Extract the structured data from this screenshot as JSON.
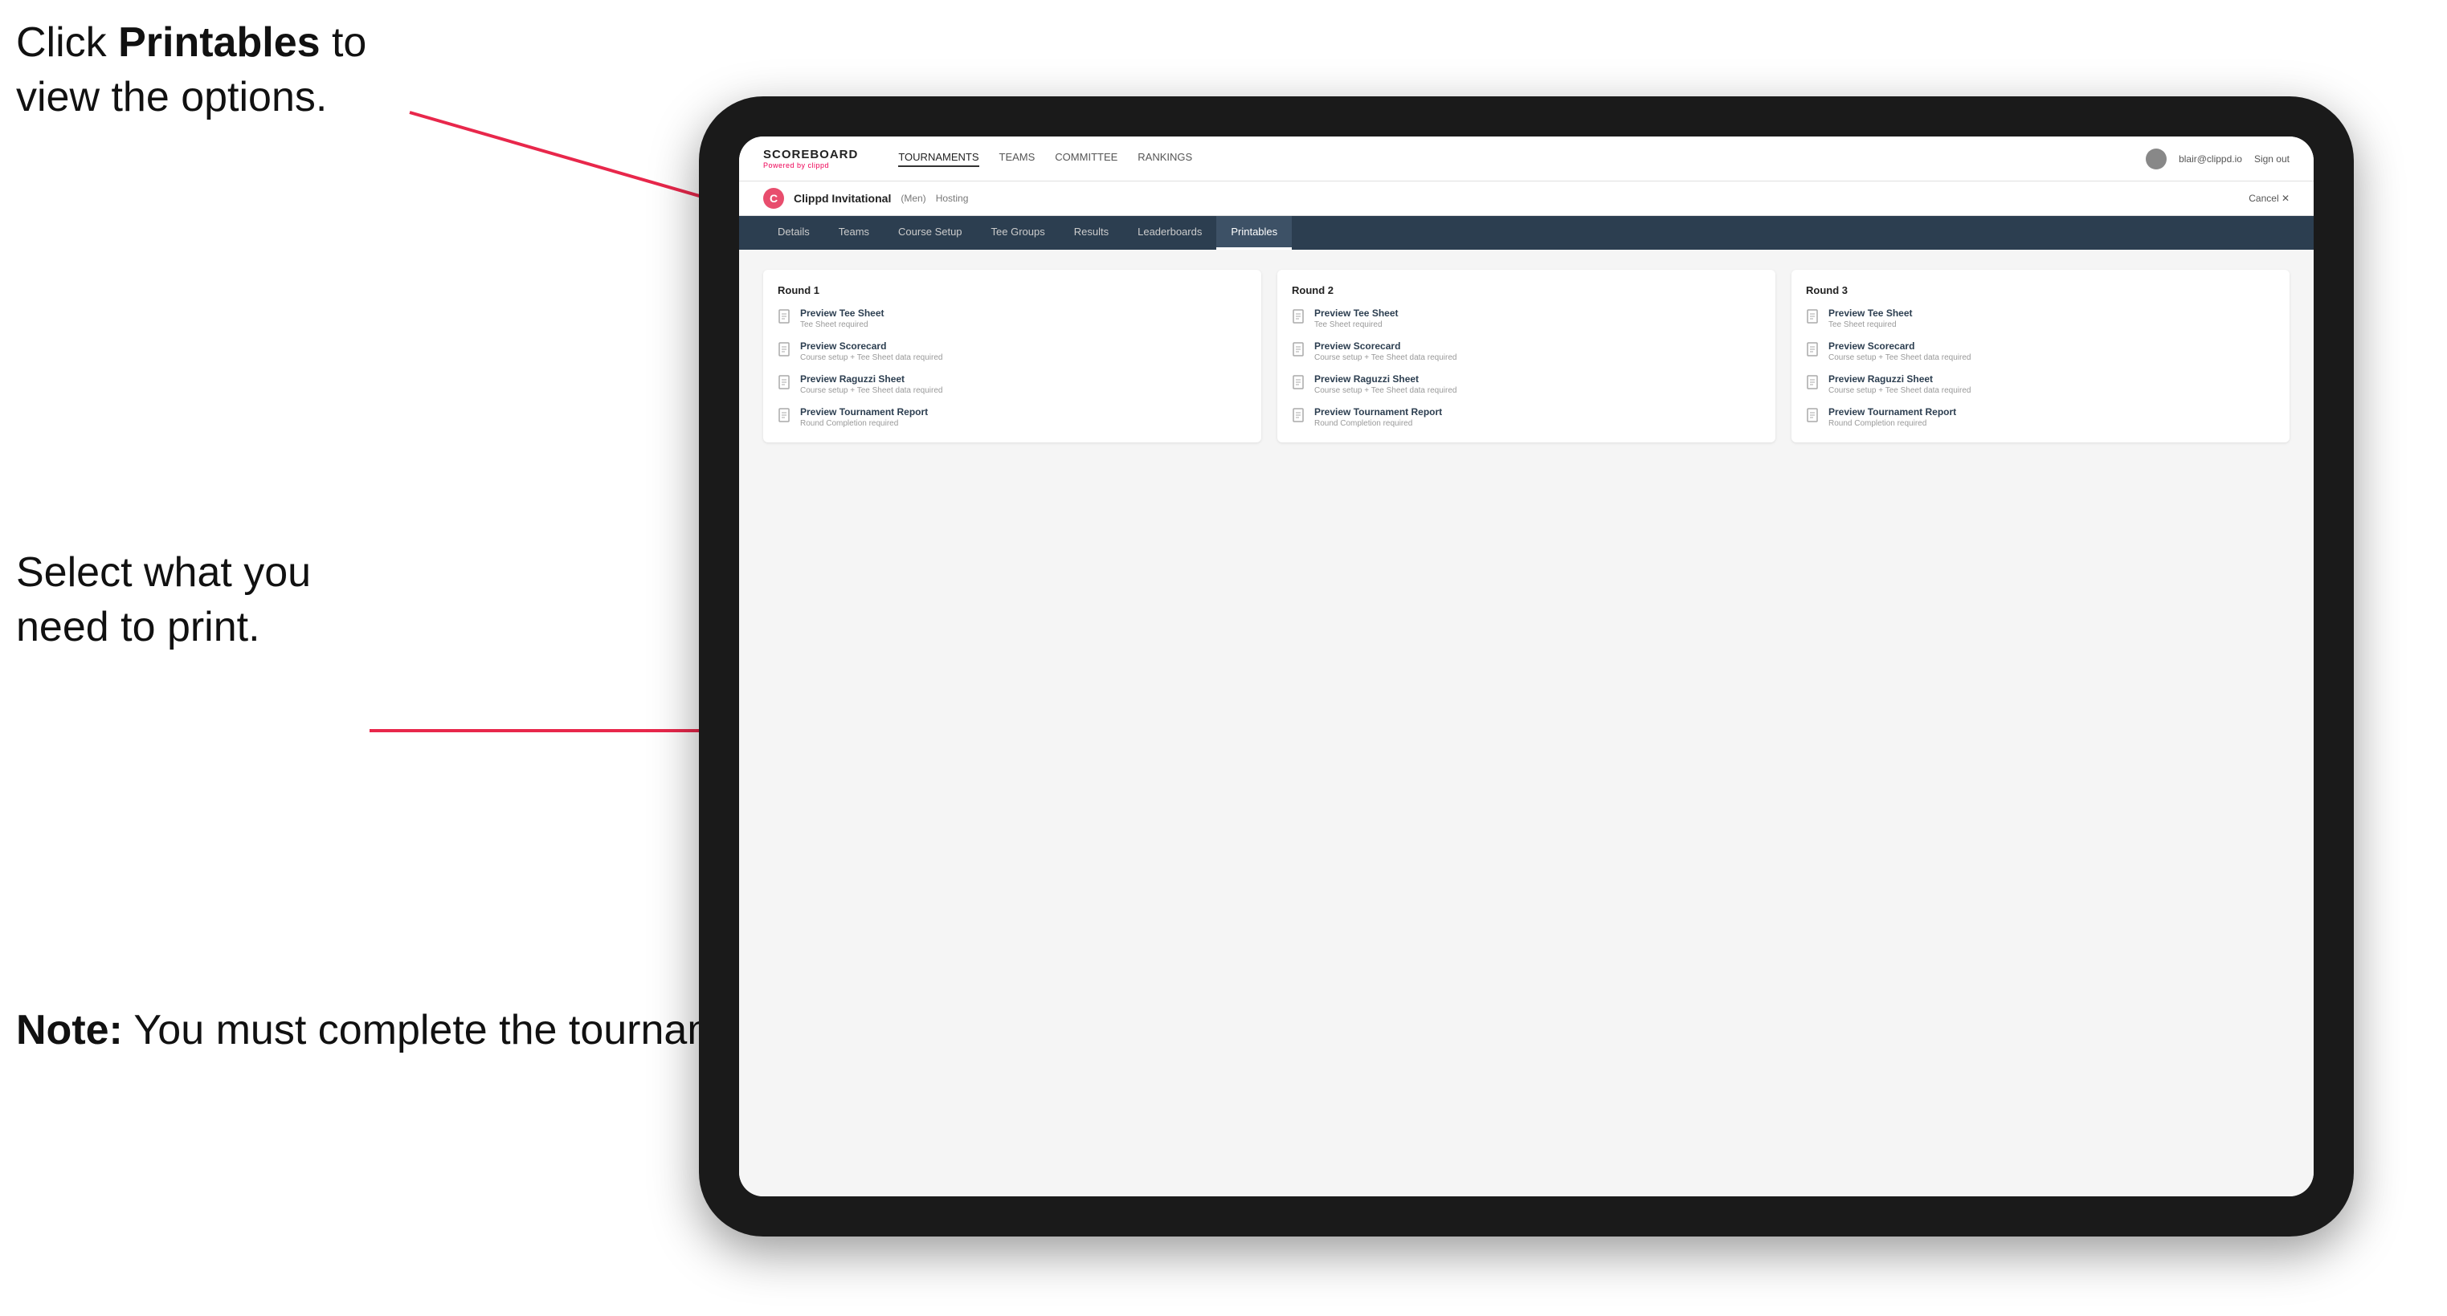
{
  "annotations": {
    "top_line1": "Click ",
    "top_bold": "Printables",
    "top_line2": " to",
    "top_line3": "view the options.",
    "middle_line1": "Select what you",
    "middle_line2": "need to print.",
    "bottom_bold": "Note:",
    "bottom_text": " You must complete the tournament set-up to print all the options."
  },
  "nav": {
    "logo": "SCOREBOARD",
    "logo_sub": "Powered by clippd",
    "links": [
      "TOURNAMENTS",
      "TEAMS",
      "COMMITTEE",
      "RANKINGS"
    ],
    "active_link": "TOURNAMENTS",
    "user_email": "blair@clippd.io",
    "sign_out": "Sign out"
  },
  "tournament": {
    "icon": "C",
    "name": "Clippd Invitational",
    "tag": "(Men)",
    "status": "Hosting",
    "cancel": "Cancel ✕"
  },
  "sub_nav": {
    "tabs": [
      "Details",
      "Teams",
      "Course Setup",
      "Tee Groups",
      "Results",
      "Leaderboards",
      "Printables"
    ],
    "active": "Printables"
  },
  "rounds": [
    {
      "title": "Round 1",
      "items": [
        {
          "title": "Preview Tee Sheet",
          "sub": "Tee Sheet required"
        },
        {
          "title": "Preview Scorecard",
          "sub": "Course setup + Tee Sheet data required"
        },
        {
          "title": "Preview Raguzzi Sheet",
          "sub": "Course setup + Tee Sheet data required"
        },
        {
          "title": "Preview Tournament Report",
          "sub": "Round Completion required"
        }
      ]
    },
    {
      "title": "Round 2",
      "items": [
        {
          "title": "Preview Tee Sheet",
          "sub": "Tee Sheet required"
        },
        {
          "title": "Preview Scorecard",
          "sub": "Course setup + Tee Sheet data required"
        },
        {
          "title": "Preview Raguzzi Sheet",
          "sub": "Course setup + Tee Sheet data required"
        },
        {
          "title": "Preview Tournament Report",
          "sub": "Round Completion required"
        }
      ]
    },
    {
      "title": "Round 3",
      "items": [
        {
          "title": "Preview Tee Sheet",
          "sub": "Tee Sheet required"
        },
        {
          "title": "Preview Scorecard",
          "sub": "Course setup + Tee Sheet data required"
        },
        {
          "title": "Preview Raguzzi Sheet",
          "sub": "Course setup + Tee Sheet data required"
        },
        {
          "title": "Preview Tournament Report",
          "sub": "Round Completion required"
        }
      ]
    }
  ]
}
